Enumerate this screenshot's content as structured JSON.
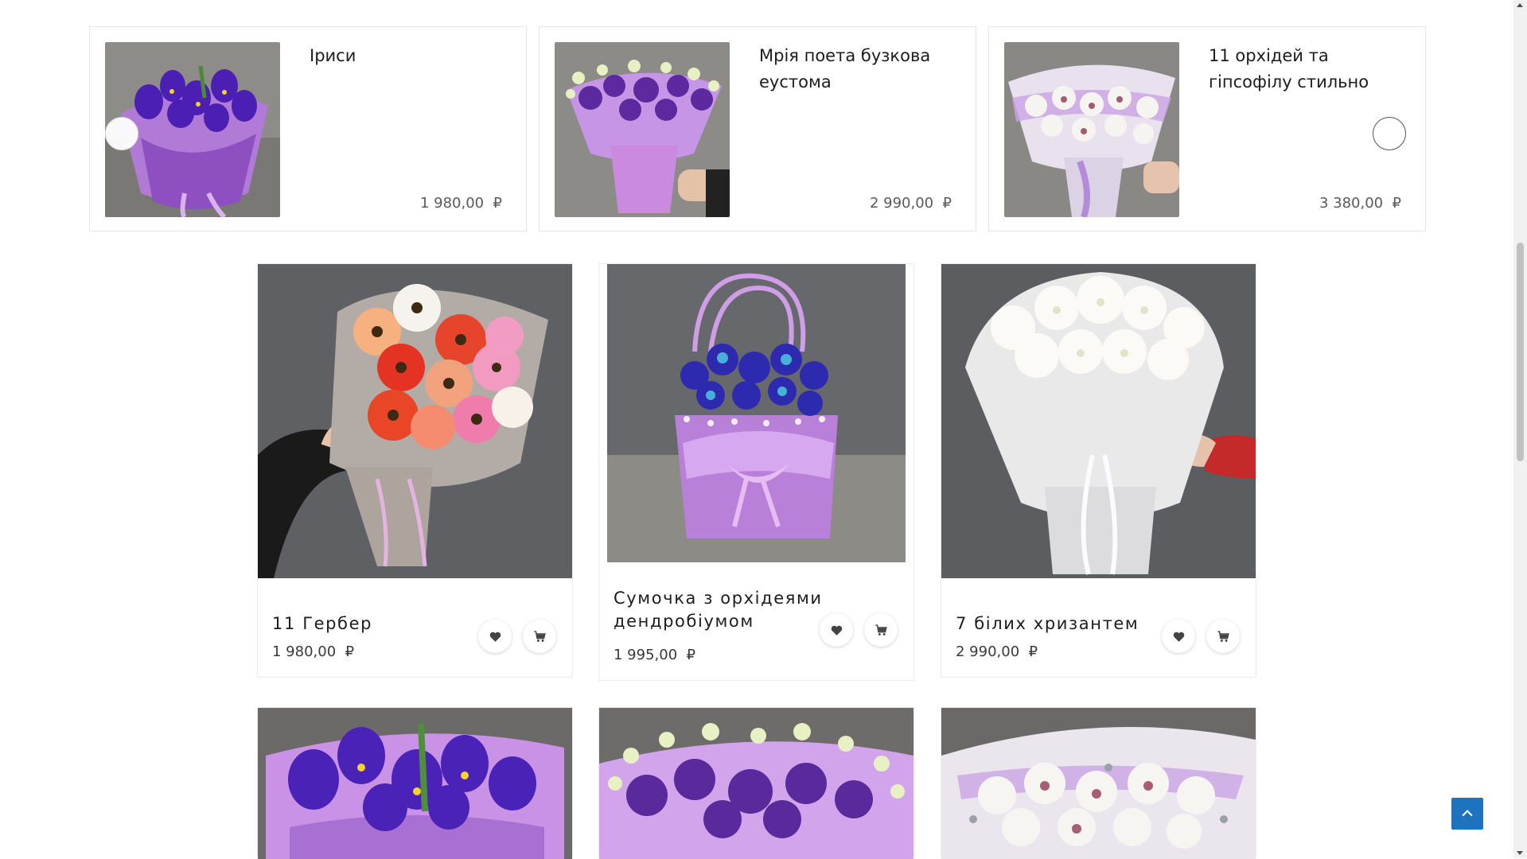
{
  "carousel": {
    "slides": [
      {
        "title": "Іриси",
        "price": "1 980,00",
        "currency": "₽"
      },
      {
        "title": "Мрія поета бузкова еустома",
        "price": "2 990,00",
        "currency": "₽"
      },
      {
        "title": "11 орхідей та гіпсофілу стильно",
        "price": "3 380,00",
        "currency": "₽"
      }
    ]
  },
  "products": [
    {
      "name": "11 Гербер",
      "price": "1 980,00",
      "currency": "₽"
    },
    {
      "name": "Сумочка з орхідеями дендробіумом",
      "price": "1 995,00",
      "currency": "₽"
    },
    {
      "name": "7 білих хризантем",
      "price": "2 990,00",
      "currency": "₽"
    }
  ],
  "icons": {
    "wishlist": "heart-icon",
    "cart": "cart-icon",
    "back_to_top": "chevron-up-icon"
  },
  "colors": {
    "accent": "#1e73be",
    "wrap_purple": "#b57be0",
    "background": "#ffffff"
  }
}
